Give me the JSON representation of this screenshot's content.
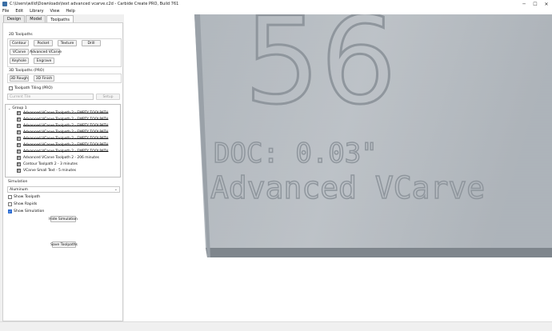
{
  "window": {
    "title": "C:\\Users\\willd\\Downloads\\text advanced vcarve.c2d - Carbide Create PRO, Build 761",
    "controls": {
      "minimize": "─",
      "maximize": "☐",
      "close": "✕"
    }
  },
  "menu": [
    "File",
    "Edit",
    "Library",
    "View",
    "Help"
  ],
  "tabs": [
    "Design",
    "Model",
    "Toolpaths"
  ],
  "toolpaths_2d": {
    "title": "2D Toolpaths",
    "buttons": [
      "Contour",
      "Pocket",
      "Texture",
      "Drill",
      "VCarve",
      "Advanced VCarve",
      "Keyhole",
      "Engrave"
    ]
  },
  "toolpaths_3d": {
    "title": "3D Toolpaths (PRO)",
    "buttons": [
      "3D Rough",
      "3D Finish"
    ]
  },
  "tiling": {
    "label": "Toolpath Tiling (PRO)",
    "checked": false,
    "current_tile": "Current Tile",
    "setup_label": "Setup"
  },
  "tree": {
    "group_label": "Group 1",
    "items": [
      {
        "label": "Advanced VCarve Toolpath 2 - EMPTY TOOLPATH",
        "strike": true
      },
      {
        "label": "Advanced VCarve Toolpath 2 - EMPTY TOOLPATH",
        "strike": true
      },
      {
        "label": "Advanced VCarve Toolpath 2 - EMPTY TOOLPATH",
        "strike": true
      },
      {
        "label": "Advanced VCarve Toolpath 2 - EMPTY TOOLPATH",
        "strike": true
      },
      {
        "label": "Advanced VCarve Toolpath 2 - EMPTY TOOLPATH",
        "strike": true
      },
      {
        "label": "Advanced VCarve Toolpath 2 - EMPTY TOOLPATH",
        "strike": true
      },
      {
        "label": "Advanced VCarve Toolpath 2 - EMPTY TOOLPATH",
        "strike": true
      },
      {
        "label": "Advanced VCarve Toolpath 2 - 206 minutes",
        "strike": false
      },
      {
        "label": "Contour Toolpath 2 - 3 minutes",
        "strike": false
      },
      {
        "label": "VCarve Small Text - 5 minutes",
        "strike": false
      }
    ]
  },
  "simulation": {
    "title": "Simulation",
    "material": "Aluminum",
    "show_toolpath": "Show Toolpath",
    "show_toolpath_checked": false,
    "show_rapids": "Show Rapids",
    "show_rapids_checked": false,
    "show_simulation": "Show Simulation",
    "show_simulation_checked": true,
    "hide_simulation_label": "Hide Simulation"
  },
  "save_toolpaths_label": "Save Toolpaths",
  "viewport": {
    "big_number": "56",
    "doc_text": "DOC: 0.03\"",
    "carve_text": "Advanced VCarve"
  },
  "colors": {
    "accent": "#2b6cd3",
    "material_surface": "#b7bcc2"
  }
}
